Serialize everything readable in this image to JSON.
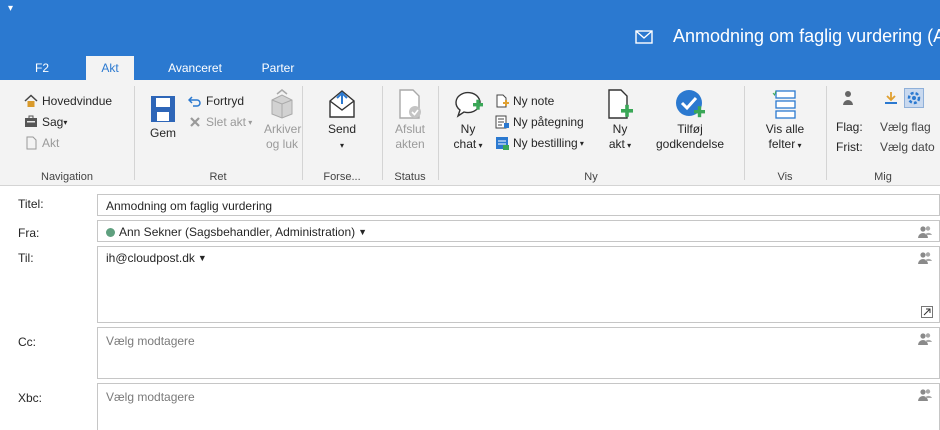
{
  "window": {
    "title": "Anmodning om faglig vurdering (A",
    "quick_access": "▾"
  },
  "tabs": [
    {
      "label": "F2",
      "active": false
    },
    {
      "label": "Akt",
      "active": true
    },
    {
      "label": "Avanceret",
      "active": false
    },
    {
      "label": "Parter",
      "active": false
    }
  ],
  "ribbon": {
    "navigation": {
      "label": "Navigation",
      "hovedvindue": "Hovedvindue",
      "sag": "Sag",
      "akt": "Akt"
    },
    "ret": {
      "label": "Ret",
      "gem": "Gem",
      "fortryd": "Fortryd",
      "slet_akt": "Slet akt",
      "arkiver_line1": "Arkiver",
      "arkiver_line2": "og luk"
    },
    "forsendelse": {
      "label": "Forse...",
      "send": "Send"
    },
    "status": {
      "label": "Status",
      "afslut_line1": "Afslut",
      "afslut_line2": "akten"
    },
    "ny": {
      "label": "Ny",
      "ny_chat_line1": "Ny",
      "ny_chat_line2": "chat",
      "ny_note": "Ny note",
      "ny_paategning": "Ny påtegning",
      "ny_bestilling": "Ny bestilling",
      "ny_akt_line1": "Ny",
      "ny_akt_line2": "akt",
      "tilfoej_line1": "Tilføj",
      "tilfoej_line2": "godkendelse"
    },
    "vis": {
      "label": "Vis",
      "vis_alle_line1": "Vis alle",
      "vis_alle_line2": "felter"
    },
    "mig": {
      "label": "Mig",
      "flag_label": "Flag:",
      "flag_value": "Vælg flag",
      "frist_label": "Frist:",
      "frist_value": "Vælg dato"
    }
  },
  "form": {
    "titel_label": "Titel:",
    "titel_value": "Anmodning om faglig vurdering",
    "fra_label": "Fra:",
    "fra_value": "Ann Sekner (Sagsbehandler, Administration)",
    "til_label": "Til:",
    "til_value": "ih@cloudpost.dk",
    "cc_label": "Cc:",
    "cc_placeholder": "Vælg modtagere",
    "xbc_label": "Xbc:",
    "xbc_placeholder": "Vælg modtagere"
  },
  "colors": {
    "accent": "#2b79d0",
    "ribbon_bg": "#f3f3f3",
    "status_dot": "#5fa07f",
    "check_blue": "#2b79d0",
    "plus_green": "#3aa757"
  }
}
